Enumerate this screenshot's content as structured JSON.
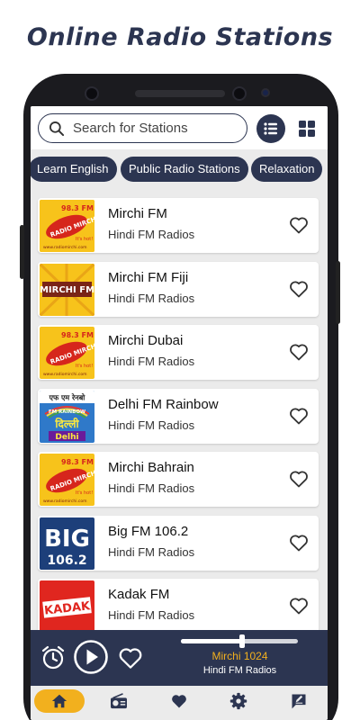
{
  "promo": {
    "title": "Online Radio Stations"
  },
  "search": {
    "placeholder": "Search for Stations",
    "value": ""
  },
  "categories": [
    "Learn English",
    "Public Radio Stations",
    "Relaxation"
  ],
  "stations": [
    {
      "name": "Mirchi FM",
      "genre": "Hindi FM Radios",
      "logo": "radio-mirchi-logo"
    },
    {
      "name": "Mirchi FM Fiji",
      "genre": "Hindi FM Radios",
      "logo": "mirchi-fm-fiji-logo"
    },
    {
      "name": "Mirchi Dubai",
      "genre": "Hindi FM Radios",
      "logo": "radio-mirchi-logo"
    },
    {
      "name": "Delhi FM Rainbow",
      "genre": "Hindi FM Radios",
      "logo": "fm-rainbow-delhi-logo"
    },
    {
      "name": "Mirchi Bahrain",
      "genre": "Hindi FM Radios",
      "logo": "radio-mirchi-logo"
    },
    {
      "name": "Big FM 106.2",
      "genre": "Hindi FM Radios",
      "logo": "big-fm-logo"
    },
    {
      "name": "Kadak FM",
      "genre": "Hindi FM Radios",
      "logo": "kadak-fm-logo"
    }
  ],
  "logo_text": {
    "mirchi_freq": "98.3 FM",
    "mirchi_brand": "RADIO MIRCHI",
    "mirchi_tag": "It's hot!",
    "mirchi_url": "www.radiomirchi.com",
    "fiji_brand": "MIRCHI FM",
    "rainbow_top": "एफ एम रेनबो",
    "rainbow_mid": "FM RAINBOW",
    "rainbow_hindi": "दिल्ली",
    "rainbow_city": "Delhi",
    "big_brand": "BIG",
    "big_freq": "106.2",
    "kadak_brand": "KADAK"
  },
  "player": {
    "title": "Mirchi 1024",
    "subtitle": "Hindi FM Radios",
    "progress": 0.52
  },
  "bottom_nav": [
    "home-icon",
    "radio-icon",
    "heart-icon",
    "gear-icon",
    "feedback-icon"
  ],
  "colors": {
    "navy": "#2c3551",
    "accent": "#f2b01e",
    "background": "#ebebeb",
    "mirchi_yellow": "#f7c31b",
    "mirchi_red": "#d6261c",
    "big_blue": "#1d3f7a",
    "kadak_red": "#e0261f"
  }
}
